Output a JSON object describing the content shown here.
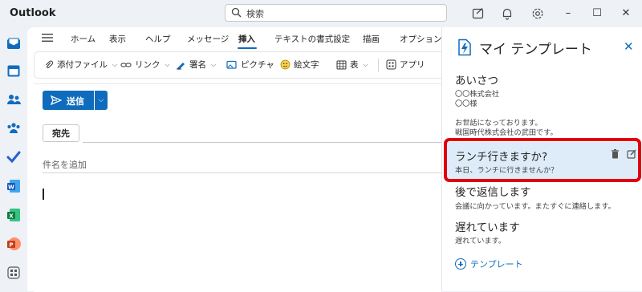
{
  "app": {
    "title": "Outlook"
  },
  "search": {
    "placeholder": "検索"
  },
  "window": {
    "minimize": "–",
    "maximize": "☐",
    "close": "✕"
  },
  "ribbon": {
    "tabs": [
      {
        "label": "ホーム"
      },
      {
        "label": "表示"
      },
      {
        "label": "ヘルプ"
      },
      {
        "label": "メッセージ"
      },
      {
        "label": "挿入",
        "active": true
      },
      {
        "label": "テキストの書式設定"
      },
      {
        "label": "描画"
      },
      {
        "label": "オプション"
      }
    ],
    "tools": {
      "attach": "添付ファイル",
      "link": "リンク",
      "signature": "署名",
      "picture": "ピクチャ",
      "emoji": "絵文字",
      "table": "表",
      "apps": "アプリ"
    }
  },
  "compose": {
    "send": "送信",
    "to": "宛先",
    "subject_placeholder": "件名を追加"
  },
  "templates": {
    "title": "マイ テンプレート",
    "items": [
      {
        "title": "あいさつ",
        "body": "〇〇株式会社\n〇〇様\n\nお世話になっております。\n戦国時代株式会社の武田です。"
      },
      {
        "title": "ランチ行きますか?",
        "body": "本日、ランチに行きませんか？"
      },
      {
        "title": "後で返信します",
        "body": "会議に向かっています。またすぐに連絡します。"
      },
      {
        "title": "遅れています",
        "body": "遅れています。"
      }
    ],
    "add_label": "テンプレート"
  },
  "colors": {
    "accent": "#0f6cbd",
    "highlight_border": "#e1000f",
    "selected_bg": "#deecf9"
  }
}
